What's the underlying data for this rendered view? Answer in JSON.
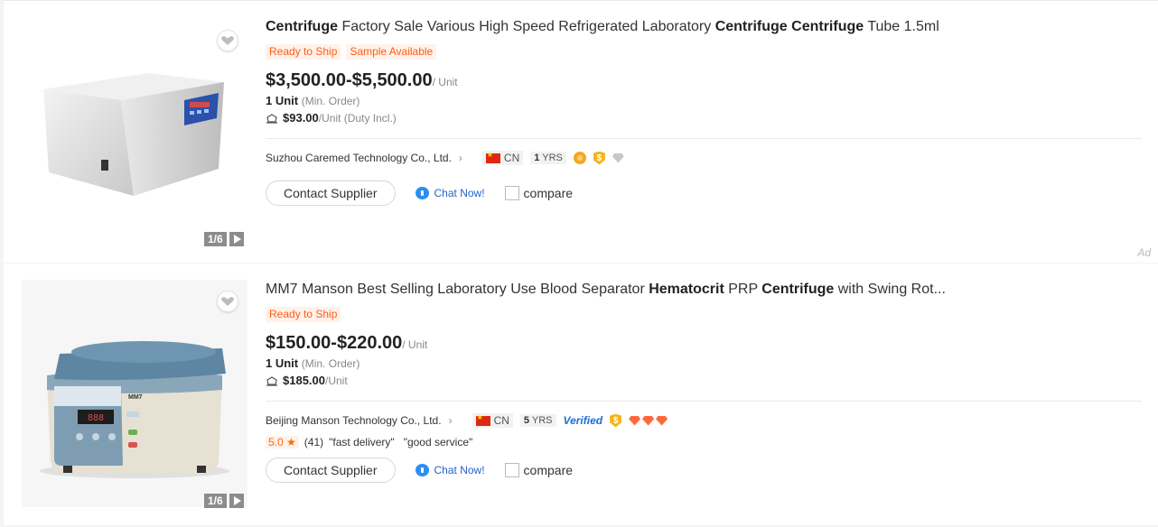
{
  "listings": [
    {
      "title_parts": [
        {
          "text": "Centrifuge",
          "bold": true
        },
        {
          "text": " Factory Sale Various High Speed Refrigerated Laboratory ",
          "bold": false
        },
        {
          "text": "Centrifuge Centrifuge",
          "bold": true
        },
        {
          "text": " Tube 1.5ml",
          "bold": false
        }
      ],
      "tags": [
        "Ready to Ship",
        "Sample Available"
      ],
      "price": "$3,500.00-$5,500.00",
      "price_unit": "/ Unit",
      "moq": "1 Unit",
      "moq_label": "(Min. Order)",
      "shipping_price": "$93.00",
      "shipping_note": "/Unit (Duty Incl.)",
      "supplier": "Suzhou Caremed Technology Co., Ltd.",
      "country": "CN",
      "years": "1",
      "years_label": "YRS",
      "image_counter": "1/6",
      "contact_label": "Contact Supplier",
      "chat_label": "Chat Now!",
      "compare_label": "compare",
      "ad_label": "Ad"
    },
    {
      "title_parts": [
        {
          "text": "MM7 Manson Best Selling Laboratory Use Blood Separator ",
          "bold": false
        },
        {
          "text": "Hematocrit",
          "bold": true
        },
        {
          "text": " PRP ",
          "bold": false
        },
        {
          "text": "Centrifuge",
          "bold": true
        },
        {
          "text": " with Swing Rot...",
          "bold": false
        }
      ],
      "tags": [
        "Ready to Ship"
      ],
      "price": "$150.00-$220.00",
      "price_unit": "/ Unit",
      "moq": "1 Unit",
      "moq_label": "(Min. Order)",
      "shipping_price": "$185.00",
      "shipping_note": "/Unit",
      "supplier": "Beijing Manson Technology Co., Ltd.",
      "country": "CN",
      "years": "5",
      "years_label": "YRS",
      "verified_label": "Verified",
      "rating_score": "5.0",
      "rating_count": "(41)",
      "review_tags": [
        "\"fast delivery\"",
        "\"good service\""
      ],
      "image_counter": "1/6",
      "device_label": "MM7",
      "contact_label": "Contact Supplier",
      "chat_label": "Chat Now!",
      "compare_label": "compare"
    }
  ],
  "colors": {
    "tag_text": "#ff5c14",
    "tag_bg": "#fff2ea",
    "link_blue": "#2264c8",
    "verified_blue": "#1a6dd6",
    "divider": "#eaeaea"
  },
  "icons": [
    "heart-icon",
    "play-icon",
    "chevron-right-icon",
    "cn-flag-icon",
    "medal-icon",
    "gold-supplier-icon",
    "diamond-icon",
    "chat-bubble-icon",
    "checkbox-icon",
    "truck-icon",
    "star-icon"
  ]
}
